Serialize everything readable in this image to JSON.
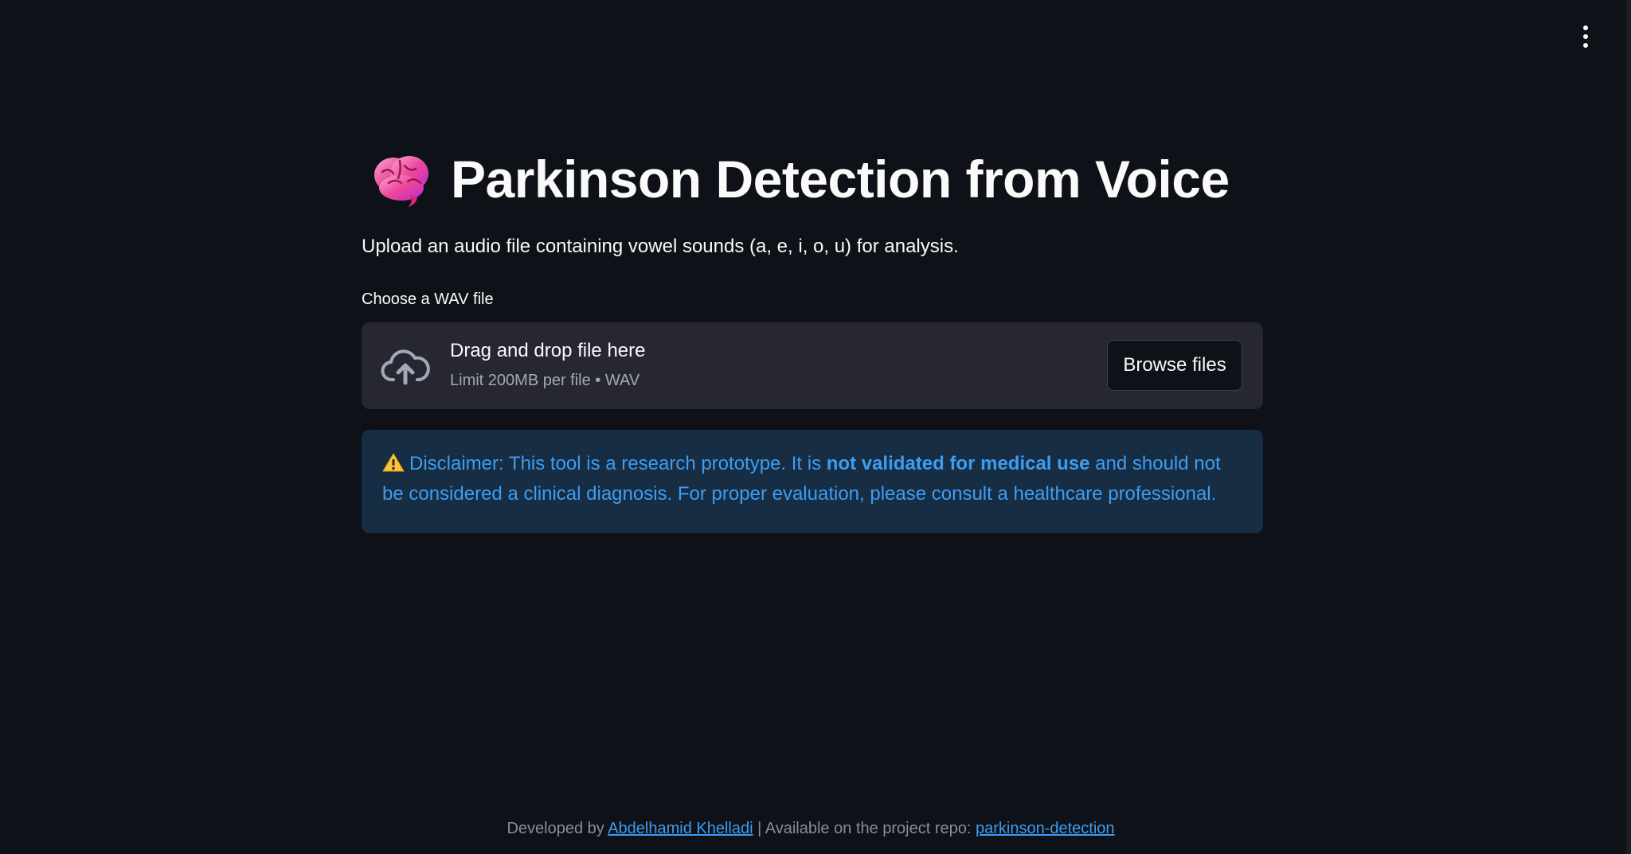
{
  "header": {
    "menu_icon": "kebab-menu-icon"
  },
  "main": {
    "title_icon": "brain-icon",
    "title": "Parkinson Detection from Voice",
    "subtitle": "Upload an audio file containing vowel sounds (a, e, i, o, u) for analysis."
  },
  "uploader": {
    "label": "Choose a WAV file",
    "icon": "cloud-upload-icon",
    "drop_title": "Drag and drop file here",
    "limit_text": "Limit 200MB per file • WAV",
    "browse_label": "Browse files"
  },
  "disclaimer": {
    "icon": "warning-icon",
    "text_before": "Disclaimer: This tool is a research prototype. It is ",
    "text_bold": "not validated for medical use",
    "text_after": " and should not be considered a clinical diagnosis. For proper evaluation, please consult a healthcare professional."
  },
  "footer": {
    "prefix": "Developed by ",
    "author_link": "Abdelhamid Khelladi",
    "separator": " | Available on the project repo: ",
    "repo_link": "parkinson-detection"
  },
  "colors": {
    "background": "#0e1117",
    "surface": "#262730",
    "info_background": "#172d43",
    "info_text": "#3d9df3",
    "link": "#3d9df3"
  }
}
